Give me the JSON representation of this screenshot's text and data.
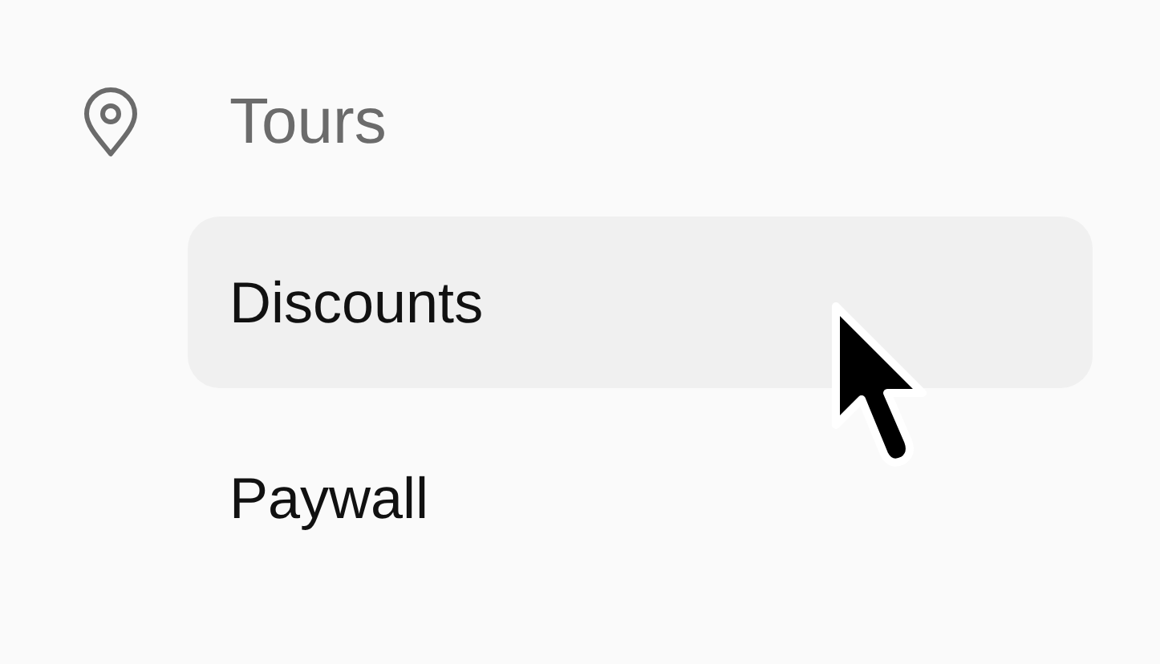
{
  "nav": {
    "label": "Tours",
    "children": [
      {
        "label": "Discounts",
        "selected": true
      },
      {
        "label": "Paywall",
        "selected": false
      }
    ]
  }
}
